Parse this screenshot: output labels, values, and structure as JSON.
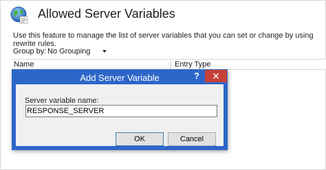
{
  "header": {
    "title": "Allowed Server Variables",
    "description": "Use this feature to manage the list of server variables that you can set or change by using rewrite rules."
  },
  "groupby": {
    "label": "Group by:",
    "value": "No Grouping"
  },
  "list": {
    "columns": [
      "Name",
      "Entry Type"
    ]
  },
  "dialog": {
    "title": "Add Server Variable",
    "help_label": "?",
    "field_label": "Server variable name:",
    "field_value": "RESPONSE_SERVER",
    "ok_label": "OK",
    "cancel_label": "Cancel"
  },
  "colors": {
    "dialog_frame": "#2d66c9",
    "close_button": "#c7403a",
    "dialog_body": "#f0f0f0"
  },
  "icons": [
    "globe-icon",
    "chevron-down-icon",
    "close-icon"
  ]
}
